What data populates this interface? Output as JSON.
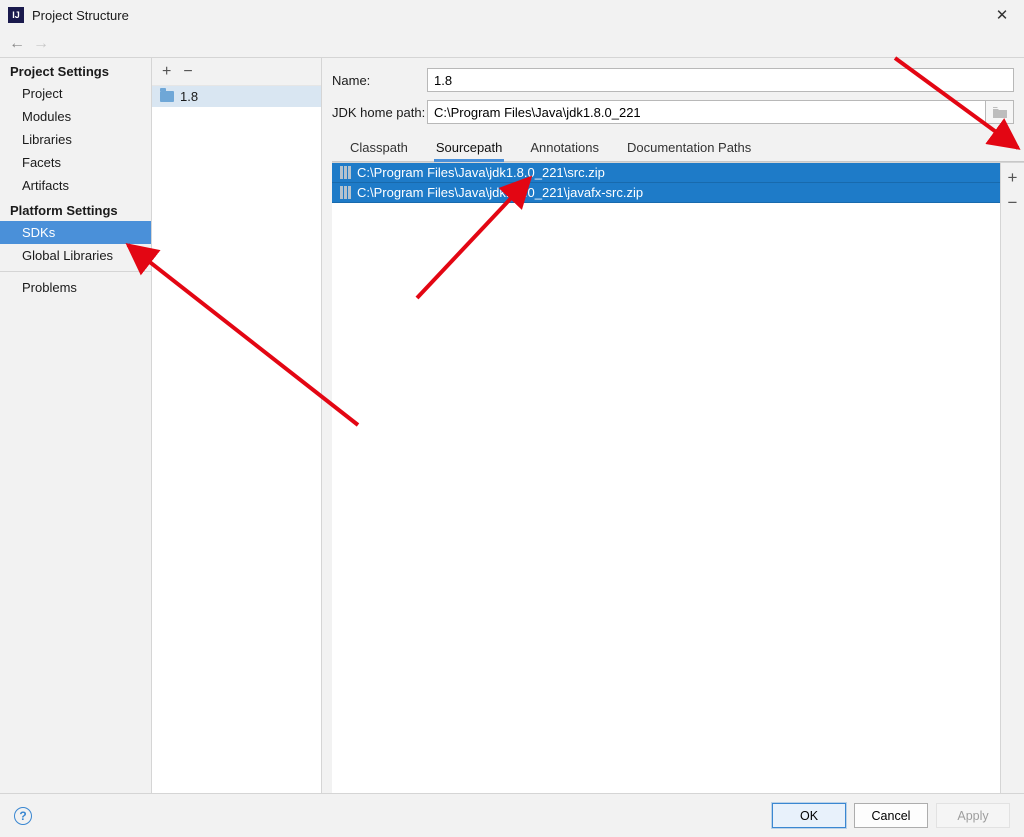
{
  "window": {
    "title": "Project Structure"
  },
  "sidebar": {
    "project_settings_label": "Project Settings",
    "platform_settings_label": "Platform Settings",
    "items": {
      "project": "Project",
      "modules": "Modules",
      "libraries": "Libraries",
      "facets": "Facets",
      "artifacts": "Artifacts",
      "sdks": "SDKs",
      "global_libraries": "Global Libraries",
      "problems": "Problems"
    }
  },
  "mid": {
    "items": [
      {
        "label": "1.8"
      }
    ]
  },
  "form": {
    "name_label": "Name:",
    "name_value": "1.8",
    "jdk_home_label": "JDK home path:",
    "jdk_home_value": "C:\\Program Files\\Java\\jdk1.8.0_221"
  },
  "tabs": {
    "classpath": "Classpath",
    "sourcepath": "Sourcepath",
    "annotations": "Annotations",
    "doc_paths": "Documentation Paths"
  },
  "paths": [
    "C:\\Program Files\\Java\\jdk1.8.0_221\\src.zip",
    "C:\\Program Files\\Java\\jdk1.8.0_221\\javafx-src.zip"
  ],
  "footer": {
    "ok": "OK",
    "cancel": "Cancel",
    "apply": "Apply"
  }
}
